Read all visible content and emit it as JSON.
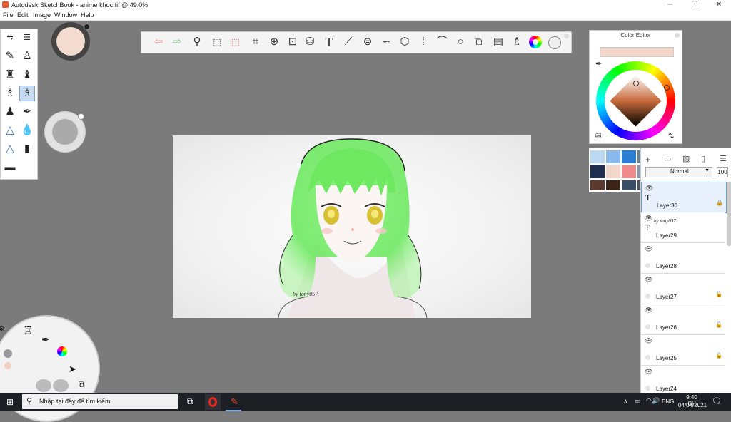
{
  "window": {
    "title": "Autodesk SketchBook - anime khoc.tif @ 49,0%"
  },
  "menu": [
    "File",
    "Edit",
    "Image",
    "Window",
    "Help"
  ],
  "toolbar": {
    "tools": [
      "undo-icon",
      "redo-icon",
      "zoom-icon",
      "select-icon",
      "transform-icon",
      "crop-icon",
      "distort-icon",
      "rect-select-icon",
      "bucket-icon",
      "text-icon",
      "ruler-icon",
      "ellipse-guide-icon",
      "french-curve-icon",
      "perspective-icon",
      "symmetry-icon",
      "stroke-icon",
      "circle-icon",
      "shape-icon",
      "copic-icon",
      "brush-library-icon",
      "color-wheel-icon"
    ]
  },
  "canvas": {
    "signature": "by tony057"
  },
  "color_editor": {
    "title": "Color Editor",
    "current_color": "#f3d7c9"
  },
  "palette": {
    "swatches": [
      "#bcd9f2",
      "#8ab9ee",
      "#2a7fd3",
      "#6e7f8e",
      "#1f2d4f",
      "#f2d7cb",
      "#f18c8c",
      "#8a98a8",
      "#5a3a2e",
      "#3b2318",
      "#3a4d66",
      "#4b5660"
    ]
  },
  "layers_panel": {
    "blend_mode": "Normal",
    "opacity": "100",
    "layers": [
      {
        "name": "Layer30",
        "type": "text",
        "selected": true,
        "locked": true
      },
      {
        "name": "Layer29",
        "type": "text",
        "selected": false,
        "locked": false,
        "preview": "by tony057"
      },
      {
        "name": "Layer28",
        "type": "paint",
        "selected": false,
        "locked": false
      },
      {
        "name": "Layer27",
        "type": "paint",
        "selected": false,
        "locked": true
      },
      {
        "name": "Layer26",
        "type": "paint",
        "selected": false,
        "locked": true
      },
      {
        "name": "Layer25",
        "type": "paint",
        "selected": false,
        "locked": true
      },
      {
        "name": "Layer24",
        "type": "paint",
        "selected": false,
        "locked": false
      }
    ]
  },
  "taskbar": {
    "search_placeholder": "Nhập tại đây để tìm kiếm",
    "time": "9:40 CH",
    "date": "04/04/2021",
    "lang": "ENG"
  }
}
